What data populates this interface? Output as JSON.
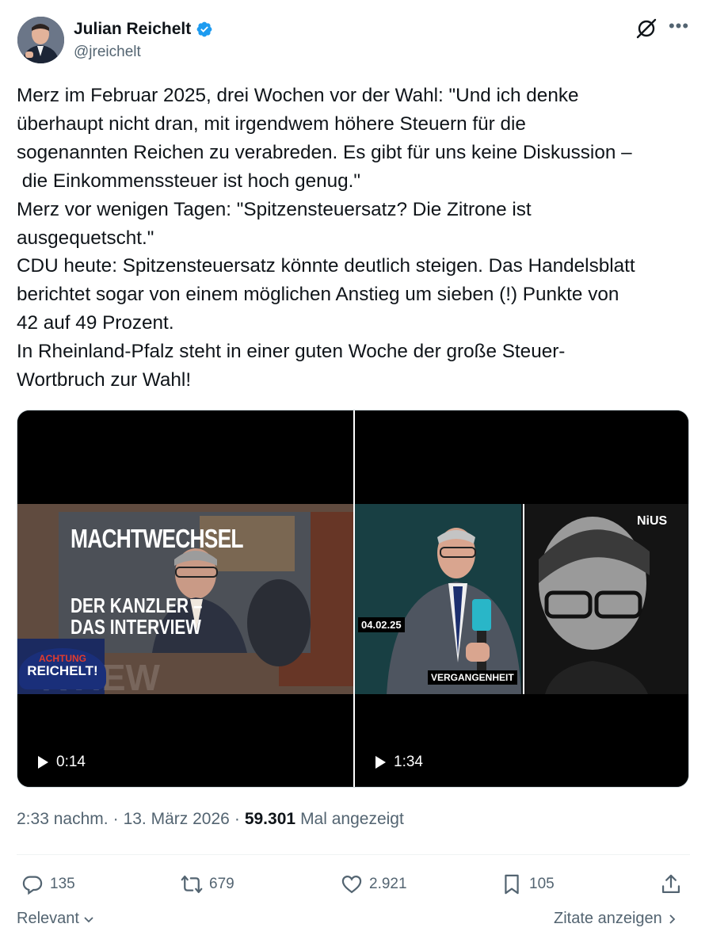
{
  "author": {
    "name": "Julian Reichelt",
    "handle": "@jreichelt",
    "verified_color": "#1d9bf0"
  },
  "tweet": {
    "lines": [
      "Merz im Februar 2025, drei Wochen vor der Wahl: \"Und ich denke",
      "überhaupt nicht dran, mit irgendwem höhere Steuern für die",
      "sogenannten Reichen zu verabreden. Es gibt für uns keine Diskussion –",
      " die Einkommenssteuer ist hoch genug.\"",
      "Merz vor wenigen Tagen: \"Spitzensteuersatz? Die Zitrone ist",
      "ausgequetscht.\"",
      "CDU heute: Spitzensteuersatz könnte deutlich steigen. Das Handelsblatt",
      "berichtet sogar von einem möglichen Anstieg um sieben (!) Punkte von",
      "42 auf 49 Prozent.",
      "In Rheinland-Pfalz steht in einer guten Woche der große Steuer-",
      "Wortbruch zur Wahl!"
    ]
  },
  "media": {
    "video1": {
      "title_top": "MACHTWECHSEL",
      "title_mid": "DER KANZLER –",
      "title_bot": "DAS INTERVIEW",
      "badge_top": "ACHTUNG",
      "badge_bot": "REICHELT!",
      "duration": "0:14"
    },
    "video2": {
      "date": "04.02.25",
      "label": "VERGANGENHEIT",
      "logo": "NiUS",
      "duration": "1:34"
    }
  },
  "meta": {
    "time": "2:33 nachm.",
    "sep1": "·",
    "date": "13. März 2026",
    "sep2": "·",
    "views": "59.301",
    "views_label": "Mal angezeigt"
  },
  "actions": {
    "replies": "135",
    "reposts": "679",
    "likes": "2.921",
    "bookmarks": "105"
  },
  "footer": {
    "sort": "Relevant",
    "quotes": "Zitate anzeigen"
  }
}
